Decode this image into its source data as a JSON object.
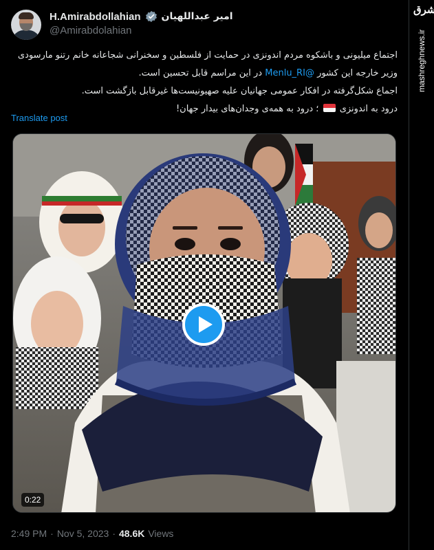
{
  "author": {
    "display_name": "H.Amirabdollahian",
    "display_name_fa": "امیر عبداللهیان",
    "handle": "@Amirabdolahian",
    "verified_icon": "verified-badge-icon"
  },
  "post": {
    "lines": [
      "اجتماع میلیونی و باشکوه مردم اندونزی در حمایت از فلسطین و سخنرانی شجاعانه خانم رتنو مارسودی",
      "در این مراسم قابل تحسین است.",
      "وزیر خارجه این کشور",
      "@Menlu_RI",
      "اجماع شکل‌گرفته در افکار عمومی جهانیان علیه صهیونیست‌ها غیرقابل بازگشت است.",
      "درود به اندونزی",
      "؛ درود به همه‌ی وجدان‌های بیدار جهان!"
    ],
    "translate_label": "Translate post"
  },
  "media": {
    "type": "video",
    "duration": "0:22",
    "play_icon": "play-icon"
  },
  "meta": {
    "time": "2:49 PM",
    "separator": "·",
    "date": "Nov 5, 2023",
    "views_count": "48.6K",
    "views_label": "Views"
  },
  "watermark": {
    "logo_text": "مشرق",
    "site": "mashreghnews.ir"
  },
  "colors": {
    "background": "#000000",
    "text": "#e7e9ea",
    "secondary": "#71767b",
    "accent": "#1d9bf0"
  }
}
